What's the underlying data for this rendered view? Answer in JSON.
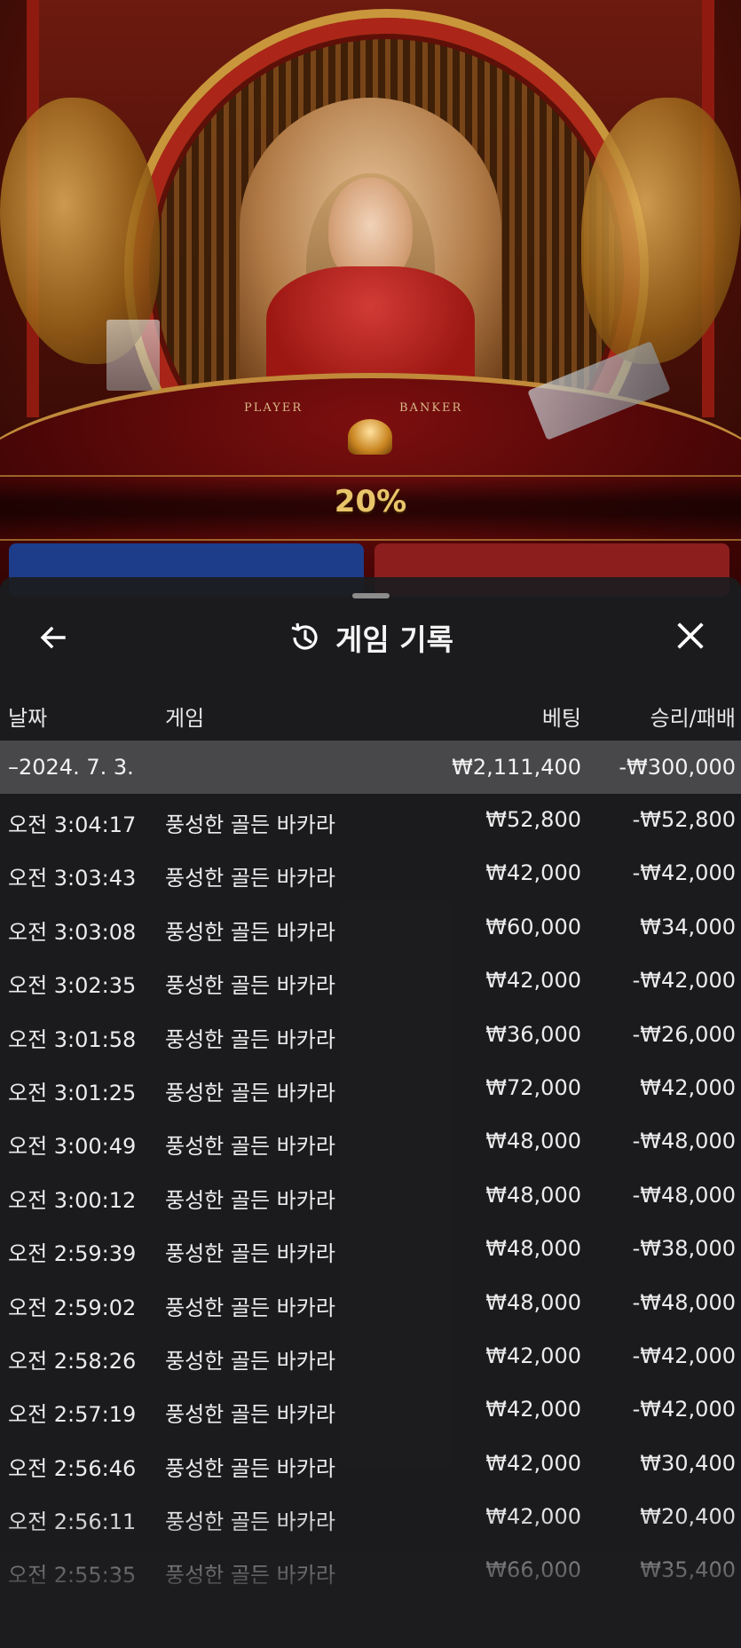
{
  "scene": {
    "table_labels": [
      "PLAYER",
      "BANKER"
    ],
    "timer": "20%"
  },
  "sheet": {
    "title": "게임 기록",
    "back_icon": "arrow-left-icon",
    "history_icon": "history-icon",
    "close_icon": "close-icon",
    "columns": {
      "date": "날짜",
      "game": "게임",
      "bet": "베팅",
      "win_loss": "승리/패배"
    },
    "day": {
      "label": "–2024. 7. 3.",
      "bet_total": "₩2,111,400",
      "win_loss_total": "-₩300,000"
    },
    "rows": [
      {
        "time": "오전 3:04:17",
        "game": "풍성한 골든 바카라",
        "bet": "₩52,800",
        "result": "-₩52,800"
      },
      {
        "time": "오전 3:03:43",
        "game": "풍성한 골든 바카라",
        "bet": "₩42,000",
        "result": "-₩42,000"
      },
      {
        "time": "오전 3:03:08",
        "game": "풍성한 골든 바카라",
        "bet": "₩60,000",
        "result": "₩34,000"
      },
      {
        "time": "오전 3:02:35",
        "game": "풍성한 골든 바카라",
        "bet": "₩42,000",
        "result": "-₩42,000"
      },
      {
        "time": "오전 3:01:58",
        "game": "풍성한 골든 바카라",
        "bet": "₩36,000",
        "result": "-₩26,000"
      },
      {
        "time": "오전 3:01:25",
        "game": "풍성한 골든 바카라",
        "bet": "₩72,000",
        "result": "₩42,000"
      },
      {
        "time": "오전 3:00:49",
        "game": "풍성한 골든 바카라",
        "bet": "₩48,000",
        "result": "-₩48,000"
      },
      {
        "time": "오전 3:00:12",
        "game": "풍성한 골든 바카라",
        "bet": "₩48,000",
        "result": "-₩48,000"
      },
      {
        "time": "오전 2:59:39",
        "game": "풍성한 골든 바카라",
        "bet": "₩48,000",
        "result": "-₩38,000"
      },
      {
        "time": "오전 2:59:02",
        "game": "풍성한 골든 바카라",
        "bet": "₩48,000",
        "result": "-₩48,000"
      },
      {
        "time": "오전 2:58:26",
        "game": "풍성한 골든 바카라",
        "bet": "₩42,000",
        "result": "-₩42,000"
      },
      {
        "time": "오전 2:57:19",
        "game": "풍성한 골든 바카라",
        "bet": "₩42,000",
        "result": "-₩42,000"
      },
      {
        "time": "오전 2:56:46",
        "game": "풍성한 골든 바카라",
        "bet": "₩42,000",
        "result": "₩30,400"
      },
      {
        "time": "오전 2:56:11",
        "game": "풍성한 골든 바카라",
        "bet": "₩42,000",
        "result": "₩20,400"
      },
      {
        "time": "오전 2:55:35",
        "game": "풍성한 골든 바카라",
        "bet": "₩66,000",
        "result": "₩35,400"
      }
    ]
  }
}
